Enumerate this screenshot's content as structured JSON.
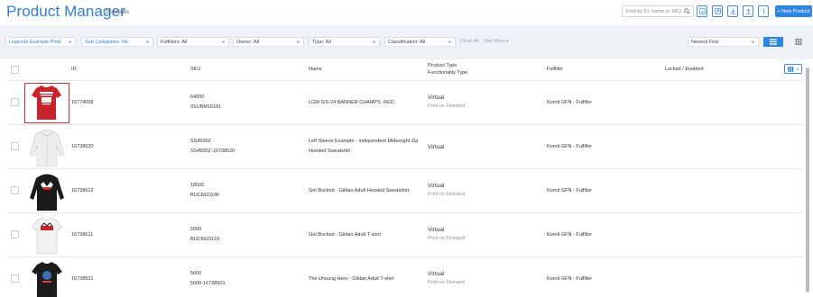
{
  "header": {
    "title": "Product Manager",
    "count": "10 results",
    "search_placeholder": "Find by ID, name or SKU...",
    "new_product": "+ New Product",
    "icons": [
      "search-icon",
      "import-icon",
      "export-icon",
      "download-icon",
      "upload-icon",
      "info-icon"
    ]
  },
  "filters": {
    "store": "Legends Example Prod",
    "subcategories": "Sub Categories: No",
    "fulfillers": "Fulfillers: All",
    "owner": "Owner: All",
    "type": "Type: All",
    "classification": "Classification: All",
    "clear_all": "Clear All",
    "see_more": "See More ▸",
    "sort": "Newest First"
  },
  "table": {
    "columns": {
      "id": "ID",
      "sku": "SKU",
      "name": "Name",
      "product_type": "Product Type",
      "functionality_type": "Functionality Type",
      "fulfiller": "Fulfiller",
      "locked": "Locked / Enabled"
    },
    "rows": [
      {
        "id": "16774058",
        "sku1": "64000",
        "sku2": "0SUBM16181",
        "name1": "LGM S/S-24 BANNER CHAMPS -RED",
        "name2": "",
        "ptype": "Virtual",
        "ftype": "Print on Demand",
        "fulfiller": "Kornit GFN - Fulfiller"
      },
      {
        "id": "16738620",
        "sku1": "SS4500Z",
        "sku2": "SS4500Z-16738620",
        "name1": "Left Sleeve Example - Independent Midweight Zip",
        "name2": "Hooded Sweatshirt",
        "ptype": "Virtual",
        "ftype": "",
        "fulfiller": "Kornit GFN - Fulfiller"
      },
      {
        "id": "16738612",
        "sku1": "18500",
        "sku2": "BUCKED246",
        "name1": "Get Bucked - Gildan Adult Hooded Sweatshirt",
        "name2": "",
        "ptype": "Virtual",
        "ftype": "Print on Demand",
        "fulfiller": "Kornit GFN - Fulfiller"
      },
      {
        "id": "16738611",
        "sku1": "5000",
        "sku2": "BUCKED123",
        "name1": "Get Bucked - Gildan Adult T-shirt",
        "name2": "",
        "ptype": "Virtual",
        "ftype": "Print on Demand",
        "fulfiller": "Kornit GFN - Fulfiller"
      },
      {
        "id": "16738501",
        "sku1": "5000",
        "sku2": "5000-16738501",
        "name1": "The Unsung Hero - Gildan Adult T-shirt",
        "name2": "",
        "ptype": "Virtual",
        "ftype": "Print on Demand",
        "fulfiller": "Kornit GFN - Fulfiller"
      }
    ]
  },
  "colors": {
    "accent": "#2f86e0",
    "title": "#2f7fd1",
    "highlight": "#e0262b",
    "filterbar_bg": "#eef1f5"
  }
}
